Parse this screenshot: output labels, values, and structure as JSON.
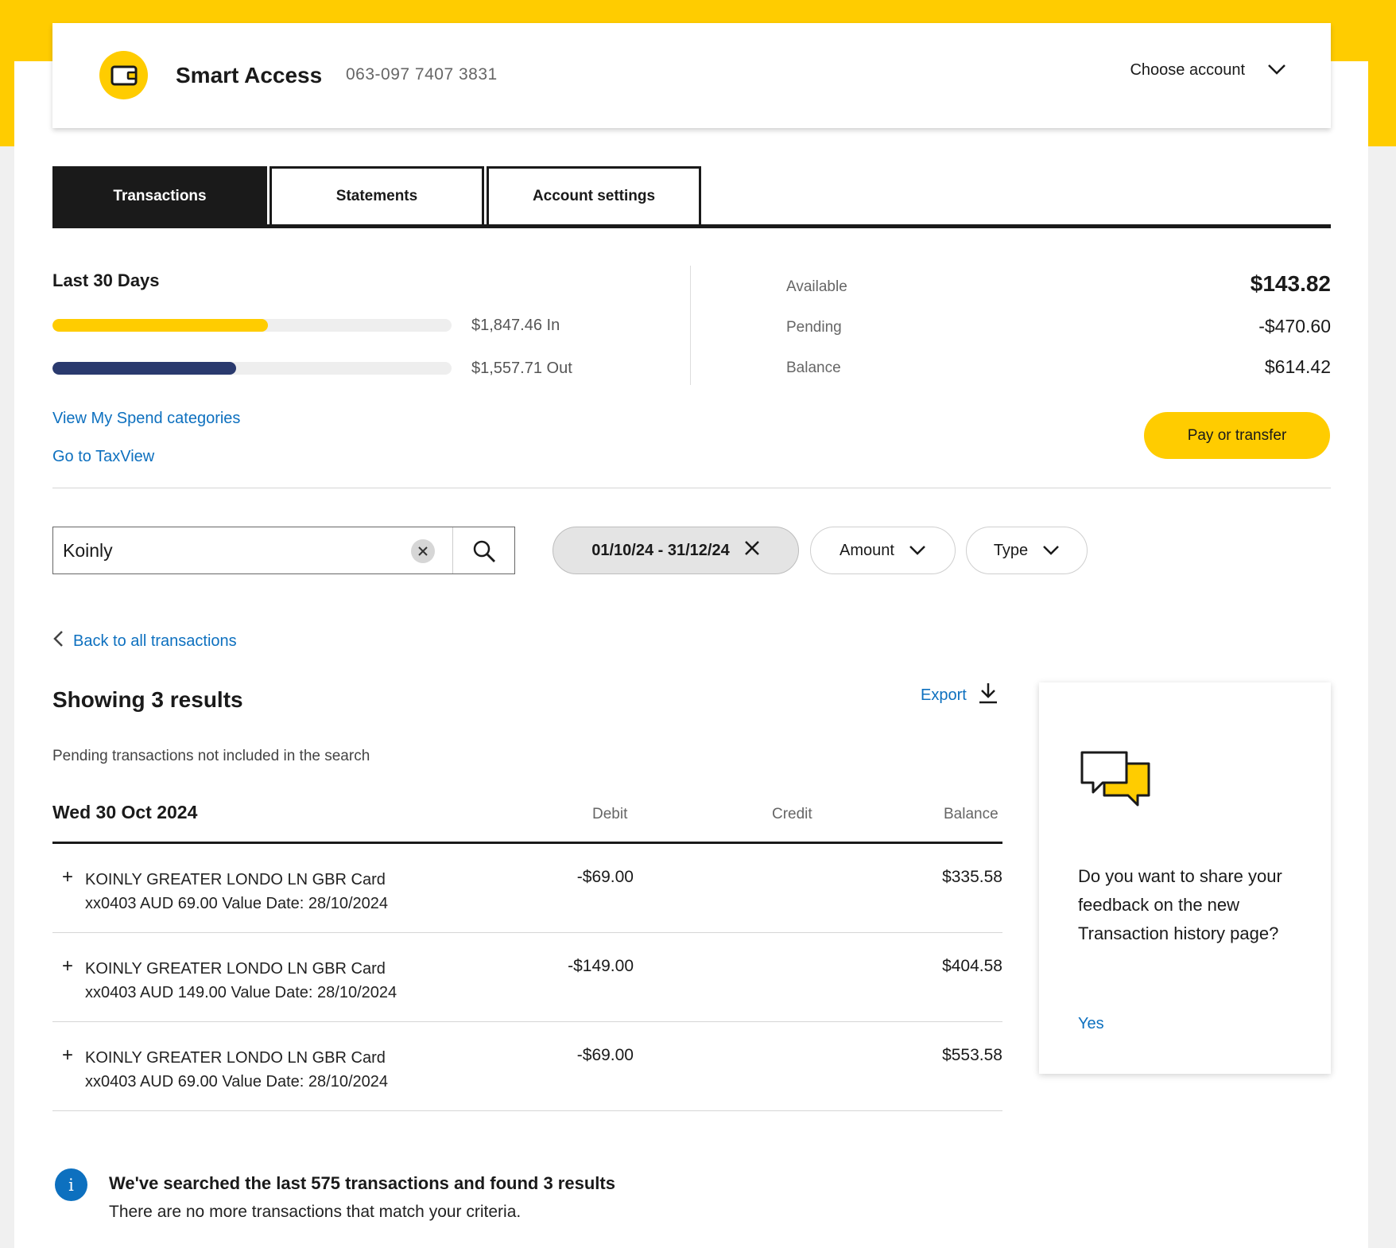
{
  "account": {
    "name": "Smart Access",
    "number": "063-097 7407 3831",
    "choose_label": "Choose account"
  },
  "tabs": [
    {
      "label": "Transactions",
      "active": true
    },
    {
      "label": "Statements",
      "active": false
    },
    {
      "label": "Account settings",
      "active": false
    }
  ],
  "summary": {
    "title": "Last 30 Days",
    "in_label": "$1,847.46 In",
    "out_label": "$1,557.71 Out",
    "in_fill_fraction": 0.54,
    "out_fill_fraction": 0.46,
    "in_color": "#ffcc00",
    "out_color": "#2a3a6e",
    "spend_link": "View My Spend categories",
    "taxview_link": "Go to TaxView"
  },
  "balances": {
    "available_label": "Available",
    "available_value": "$143.82",
    "pending_label": "Pending",
    "pending_value": "-$470.60",
    "balance_label": "Balance",
    "balance_value": "$614.42"
  },
  "pay_button": "Pay or transfer",
  "search": {
    "value": "Koinly"
  },
  "filters": {
    "date_range": "01/10/24 - 31/12/24",
    "amount_label": "Amount",
    "type_label": "Type"
  },
  "back_link": "Back to all transactions",
  "results": {
    "title": "Showing 3 results",
    "export_label": "Export",
    "pending_note": "Pending transactions not included in the search",
    "date_heading": "Wed 30 Oct 2024",
    "columns": {
      "debit": "Debit",
      "credit": "Credit",
      "balance": "Balance"
    },
    "rows": [
      {
        "line1": "KOINLY GREATER LONDO LN GBR Card",
        "line2": "xx0403 AUD 69.00 Value Date: 28/10/2024",
        "debit": "-$69.00",
        "credit": "",
        "balance": "$335.58"
      },
      {
        "line1": "KOINLY GREATER LONDO LN GBR Card",
        "line2": "xx0403 AUD 149.00 Value Date: 28/10/2024",
        "debit": "-$149.00",
        "credit": "",
        "balance": "$404.58"
      },
      {
        "line1": "KOINLY GREATER LONDO LN GBR Card",
        "line2": "xx0403 AUD 69.00 Value Date: 28/10/2024",
        "debit": "-$69.00",
        "credit": "",
        "balance": "$553.58"
      }
    ]
  },
  "feedback": {
    "question": "Do you want to share your feedback on the new Transaction history page?",
    "yes_label": "Yes"
  },
  "info": {
    "title": "We've searched the last 575 transactions and found 3 results",
    "subtitle": "There are no more transactions that match your criteria."
  },
  "icons": [
    "wallet-icon",
    "chevron-down-icon",
    "clear-icon",
    "search-icon",
    "close-icon",
    "chevron-left-icon",
    "download-icon",
    "plus-icon",
    "chat-bubbles-icon",
    "info-icon"
  ],
  "colors": {
    "brand_yellow": "#ffcc00",
    "link_blue": "#0d70bf",
    "dark": "#1a1a1a"
  }
}
